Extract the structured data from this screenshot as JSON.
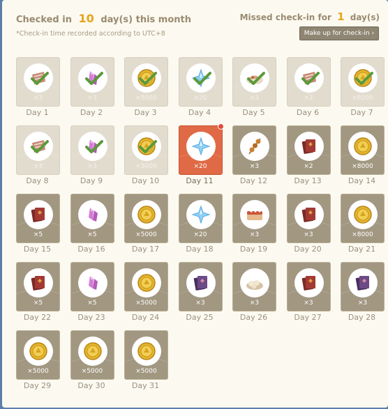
{
  "header": {
    "checked_prefix": "Checked in",
    "checked_count": "10",
    "checked_suffix": "day(s) this month",
    "note": "*Check-in time recorded according to UTC+8",
    "missed_prefix": "Missed check-in for",
    "missed_count": "1",
    "missed_suffix": "day(s)",
    "makeup_label": "Make up for check-in",
    "makeup_chevron": "›"
  },
  "colors": {
    "accent": "#e8a31a",
    "today_card": "#e06a46",
    "check": "#5a9a3a",
    "card_unclaimed": "#a29781",
    "card_claimed": "#e2dccf"
  },
  "days": [
    {
      "label": "Day 1",
      "qty": "×3",
      "icon": "meat-icon",
      "state": "claimed"
    },
    {
      "label": "Day 2",
      "qty": "×3",
      "icon": "crystal-icon",
      "state": "claimed"
    },
    {
      "label": "Day 3",
      "qty": "×5000",
      "icon": "coin-icon",
      "state": "claimed"
    },
    {
      "label": "Day 4",
      "qty": "×20",
      "icon": "star-crystal-icon",
      "state": "claimed"
    },
    {
      "label": "Day 5",
      "qty": "×3",
      "icon": "dish-icon",
      "state": "claimed"
    },
    {
      "label": "Day 6",
      "qty": "×2",
      "icon": "meat-icon",
      "state": "claimed"
    },
    {
      "label": "Day 7",
      "qty": "×8000",
      "icon": "coin-icon",
      "state": "claimed"
    },
    {
      "label": "Day 8",
      "qty": "×3",
      "icon": "meat-icon",
      "state": "claimed"
    },
    {
      "label": "Day 9",
      "qty": "×3",
      "icon": "crystal-icon",
      "state": "claimed"
    },
    {
      "label": "Day 10",
      "qty": "×5000",
      "icon": "coin-icon",
      "state": "claimed"
    },
    {
      "label": "Day 11",
      "qty": "×20",
      "icon": "star-crystal-icon",
      "state": "today"
    },
    {
      "label": "Day 12",
      "qty": "×3",
      "icon": "skewer-icon",
      "state": "unclaimed"
    },
    {
      "label": "Day 13",
      "qty": "×2",
      "icon": "book-red-icon",
      "state": "unclaimed"
    },
    {
      "label": "Day 14",
      "qty": "×8000",
      "icon": "coin-icon",
      "state": "unclaimed"
    },
    {
      "label": "Day 15",
      "qty": "×5",
      "icon": "book-red-icon",
      "state": "unclaimed"
    },
    {
      "label": "Day 16",
      "qty": "×5",
      "icon": "crystal-icon",
      "state": "unclaimed"
    },
    {
      "label": "Day 17",
      "qty": "×5000",
      "icon": "coin-icon",
      "state": "unclaimed"
    },
    {
      "label": "Day 18",
      "qty": "×20",
      "icon": "star-crystal-icon",
      "state": "unclaimed"
    },
    {
      "label": "Day 19",
      "qty": "×3",
      "icon": "cake-icon",
      "state": "unclaimed"
    },
    {
      "label": "Day 20",
      "qty": "×3",
      "icon": "book-red-icon",
      "state": "unclaimed"
    },
    {
      "label": "Day 21",
      "qty": "×8000",
      "icon": "coin-icon",
      "state": "unclaimed"
    },
    {
      "label": "Day 22",
      "qty": "×5",
      "icon": "book-red-icon",
      "state": "unclaimed"
    },
    {
      "label": "Day 23",
      "qty": "×5",
      "icon": "crystal-icon",
      "state": "unclaimed"
    },
    {
      "label": "Day 24",
      "qty": "×5000",
      "icon": "coin-icon",
      "state": "unclaimed"
    },
    {
      "label": "Day 25",
      "qty": "×3",
      "icon": "book-purple-icon",
      "state": "unclaimed"
    },
    {
      "label": "Day 26",
      "qty": "×3",
      "icon": "dumpling-icon",
      "state": "unclaimed"
    },
    {
      "label": "Day 27",
      "qty": "×3",
      "icon": "book-red-icon",
      "state": "unclaimed"
    },
    {
      "label": "Day 28",
      "qty": "×3",
      "icon": "book-purple-icon",
      "state": "unclaimed"
    },
    {
      "label": "Day 29",
      "qty": "×5000",
      "icon": "coin-icon",
      "state": "unclaimed"
    },
    {
      "label": "Day 30",
      "qty": "×5000",
      "icon": "coin-icon",
      "state": "unclaimed"
    },
    {
      "label": "Day 31",
      "qty": "×5000",
      "icon": "coin-icon",
      "state": "unclaimed"
    }
  ]
}
